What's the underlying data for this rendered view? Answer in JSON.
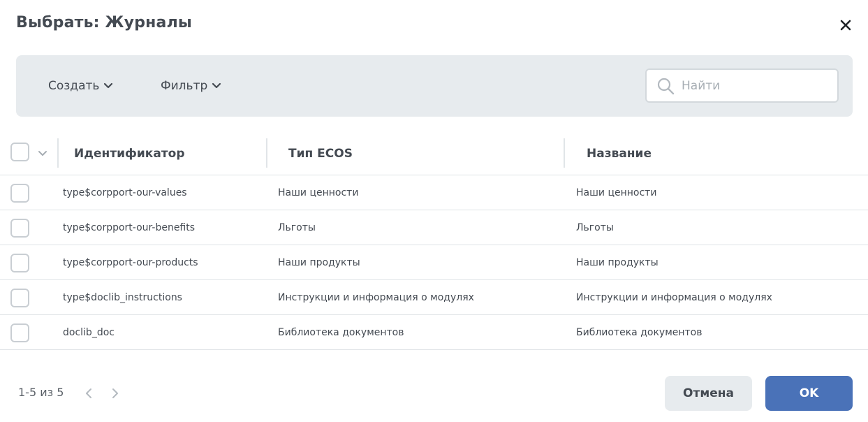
{
  "dialog": {
    "title": "Выбрать: Журналы"
  },
  "toolbar": {
    "create_label": "Создать",
    "filter_label": "Фильтр",
    "search_placeholder": "Найти"
  },
  "table": {
    "columns": [
      "Идентификатор",
      "Тип ECOS",
      "Название"
    ],
    "rows": [
      {
        "id": "type$corpport-our-values",
        "type": "Наши ценности",
        "name": "Наши ценности"
      },
      {
        "id": "type$corpport-our-benefits",
        "type": "Льготы",
        "name": "Льготы"
      },
      {
        "id": "type$corpport-our-products",
        "type": "Наши продукты",
        "name": "Наши продукты"
      },
      {
        "id": "type$doclib_instructions",
        "type": "Инструкции и информация о модулях",
        "name": "Инструкции и информация о модулях"
      },
      {
        "id": "doclib_doc",
        "type": "Библиотека документов",
        "name": "Библиотека документов"
      }
    ]
  },
  "pagination": {
    "summary": "1-5 из 5"
  },
  "footer": {
    "cancel_label": "Отмена",
    "ok_label": "OK"
  },
  "colors": {
    "accent": "#4a72b8",
    "toolbar_bg": "#e7ebee",
    "text": "#444a52"
  }
}
